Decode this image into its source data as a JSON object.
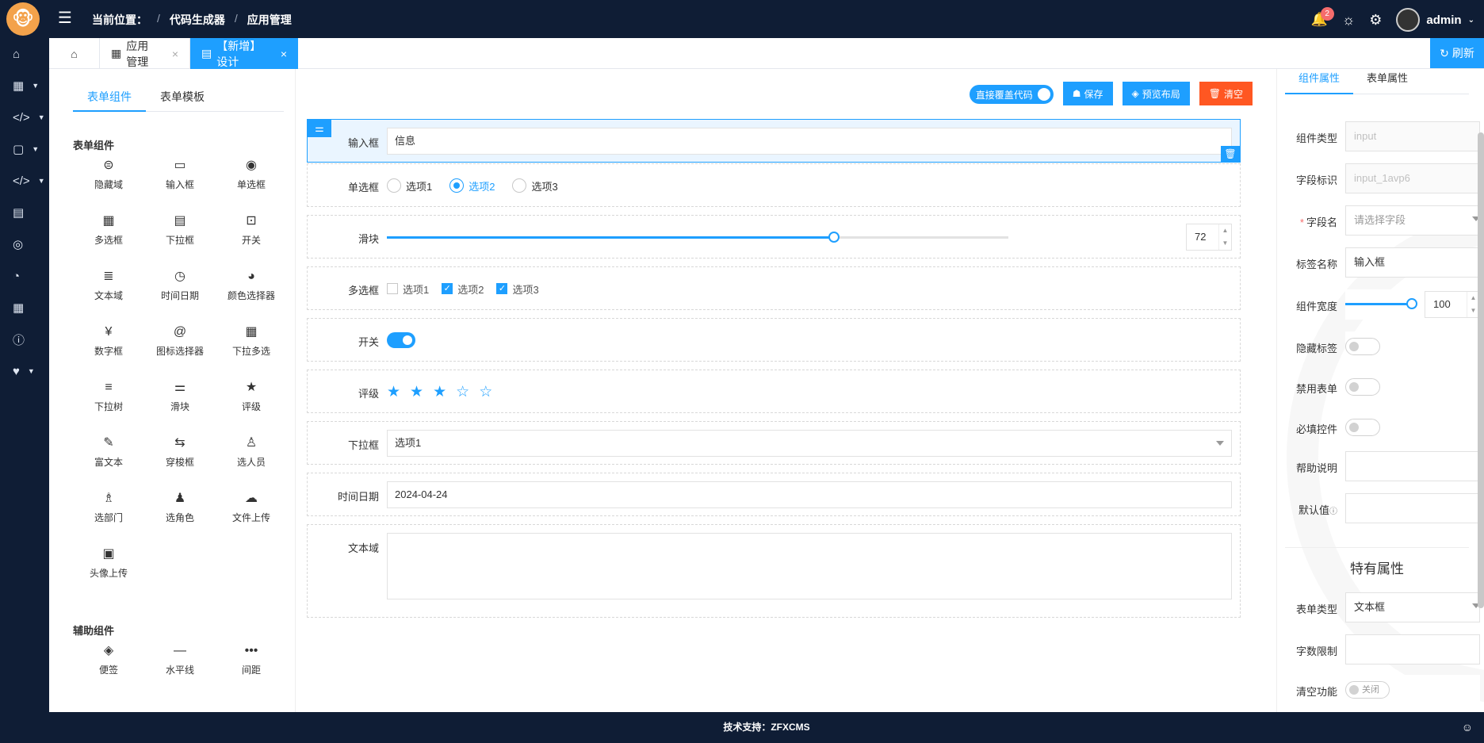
{
  "header": {
    "breadcrumb_prefix": "当前位置：",
    "crumb1": "代码生成器",
    "crumb2": "应用管理",
    "notification_count": "2",
    "user_name": "admin"
  },
  "tabs": {
    "tab1": "应用管理",
    "tab2": "【新增】设计",
    "refresh": "刷新"
  },
  "left": {
    "tab_components": "表单组件",
    "tab_templates": "表单模板",
    "group_form": "表单组件",
    "group_aux": "辅助组件",
    "form_components": [
      {
        "label": "隐藏域",
        "icon": "hidden-field-icon",
        "glyph": "⊜"
      },
      {
        "label": "输入框",
        "icon": "input-icon",
        "glyph": "▭"
      },
      {
        "label": "单选框",
        "icon": "radio-icon",
        "glyph": "◉"
      },
      {
        "label": "多选框",
        "icon": "checkbox-icon",
        "glyph": "▦"
      },
      {
        "label": "下拉框",
        "icon": "select-icon",
        "glyph": "▤"
      },
      {
        "label": "开关",
        "icon": "switch-icon",
        "glyph": "⊡"
      },
      {
        "label": "文本域",
        "icon": "textarea-icon",
        "glyph": "≣"
      },
      {
        "label": "时间日期",
        "icon": "clock-icon",
        "glyph": "◷"
      },
      {
        "label": "颜色选择器",
        "icon": "palette-icon",
        "glyph": "◕"
      },
      {
        "label": "数字框",
        "icon": "yen-icon",
        "glyph": "¥"
      },
      {
        "label": "图标选择器",
        "icon": "at-icon",
        "glyph": "@"
      },
      {
        "label": "下拉多选",
        "icon": "multi-select-icon",
        "glyph": "▦"
      },
      {
        "label": "下拉树",
        "icon": "tree-icon",
        "glyph": "≡"
      },
      {
        "label": "滑块",
        "icon": "sliders-icon",
        "glyph": "⚌"
      },
      {
        "label": "评级",
        "icon": "star-icon",
        "glyph": "★"
      },
      {
        "label": "富文本",
        "icon": "brush-icon",
        "glyph": "✎"
      },
      {
        "label": "穿梭框",
        "icon": "transfer-icon",
        "glyph": "⇆"
      },
      {
        "label": "选人员",
        "icon": "user-icon",
        "glyph": "♙"
      },
      {
        "label": "选部门",
        "icon": "department-icon",
        "glyph": "♗"
      },
      {
        "label": "选角色",
        "icon": "users-icon",
        "glyph": "♟"
      },
      {
        "label": "文件上传",
        "icon": "cloud-upload-icon",
        "glyph": "☁"
      },
      {
        "label": "头像上传",
        "icon": "image-icon",
        "glyph": "▣"
      }
    ],
    "aux_components": [
      {
        "label": "便签",
        "icon": "tag-icon",
        "glyph": "◈"
      },
      {
        "label": "水平线",
        "icon": "hr-icon",
        "glyph": "—"
      },
      {
        "label": "间距",
        "icon": "dots-icon",
        "glyph": "•••"
      }
    ]
  },
  "toolbar": {
    "overwrite_label": "直接覆盖代码",
    "save_label": "保存",
    "preview_label": "预览布局",
    "clear_label": "清空"
  },
  "form": {
    "input_label": "输入框",
    "input_value": "信息",
    "radio_label": "单选框",
    "radio_options": [
      "选项1",
      "选项2",
      "选项3"
    ],
    "radio_selected": 1,
    "slider_label": "滑块",
    "slider_value": "72",
    "checkbox_label": "多选框",
    "checkbox_options": [
      "选项1",
      "选项2",
      "选项3"
    ],
    "checkbox_checked": [
      false,
      true,
      true
    ],
    "switch_label": "开关",
    "rate_label": "评级",
    "rate_value": 3,
    "rate_max": 5,
    "select_label": "下拉框",
    "select_value": "选项1",
    "date_label": "时间日期",
    "date_value": "2024-04-24",
    "textarea_label": "文本域"
  },
  "props": {
    "tab_component": "组件属性",
    "tab_form": "表单属性",
    "type_label": "组件类型",
    "type_value": "input",
    "id_label": "字段标识",
    "id_value": "input_1avp6",
    "field_label": "字段名",
    "field_placeholder": "请选择字段",
    "title_label": "标签名称",
    "title_value": "输入框",
    "width_label": "组件宽度",
    "width_value": "100",
    "hide_label": "隐藏标签",
    "disabled_label": "禁用表单",
    "required_label": "必填控件",
    "help_label": "帮助说明",
    "default_label": "默认值",
    "special_title": "特有属性",
    "form_type_label": "表单类型",
    "form_type_value": "文本框",
    "maxlength_label": "字数限制",
    "clearable_label": "清空功能",
    "clearable_state": "关闭"
  },
  "footer": {
    "text": "技术支持：ZFXCMS"
  },
  "colors": {
    "primary": "#1e9fff",
    "danger": "#ff5722",
    "nav_bg": "#0f1d35"
  }
}
